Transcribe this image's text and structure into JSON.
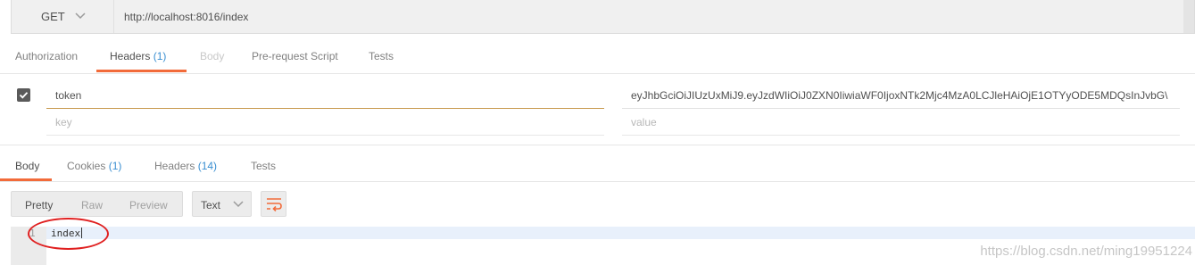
{
  "request": {
    "method": "GET",
    "url": "http://localhost:8016/index"
  },
  "request_tabs": [
    {
      "label": "Authorization"
    },
    {
      "label": "Headers",
      "count": "(1)"
    },
    {
      "label": "Body"
    },
    {
      "label": "Pre-request Script"
    },
    {
      "label": "Tests"
    }
  ],
  "headers": {
    "rows": [
      {
        "checked": true,
        "key": "token",
        "value": "eyJhbGciOiJIUzUxMiJ9.eyJzdWIiOiJ0ZXN0IiwiaWF0IjoxNTk2Mjc4MzA0LCJleHAiOjE1OTYyODE5MDQsInJvbG\\"
      }
    ],
    "key_placeholder": "key",
    "value_placeholder": "value"
  },
  "response_tabs": [
    {
      "label": "Body"
    },
    {
      "label": "Cookies",
      "count": "(1)"
    },
    {
      "label": "Headers",
      "count": "(14)"
    },
    {
      "label": "Tests"
    }
  ],
  "response_view": {
    "modes": [
      "Pretty",
      "Raw",
      "Preview"
    ],
    "type": "Text"
  },
  "response_body": {
    "line_number": "1",
    "text": "index"
  },
  "watermark": "https://blog.csdn.net/ming19951224",
  "colors": {
    "accent": "#f26b3a",
    "count": "#3a8fd1",
    "annotation": "#e02020"
  }
}
